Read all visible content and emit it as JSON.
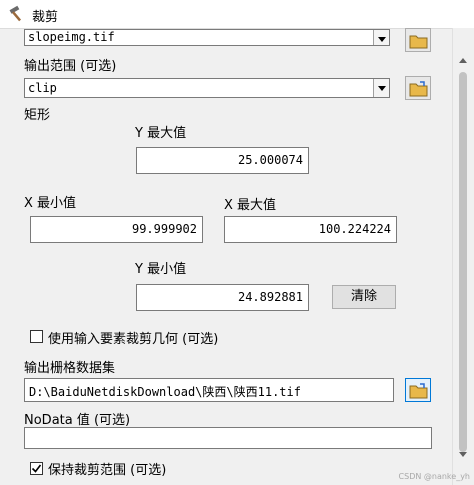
{
  "window": {
    "title": "裁剪",
    "icon": "hammer-icon"
  },
  "input_raster": {
    "value": "slopeimg.tif"
  },
  "output_extent": {
    "label": "输出范围 (可选)",
    "value": "clip"
  },
  "rectangle": {
    "label": "矩形",
    "y_max_label": "Y 最大值",
    "y_max": "25.000074",
    "x_min_label": "X 最小值",
    "x_min": "99.999902",
    "x_max_label": "X 最大值",
    "x_max": "100.224224",
    "y_min_label": "Y 最小值",
    "y_min": "24.892881",
    "clear_label": "清除"
  },
  "use_input_features": {
    "label": "使用输入要素裁剪几何 (可选)",
    "checked": false
  },
  "output_raster": {
    "label": "输出栅格数据集",
    "value": "D:\\BaiduNetdiskDownload\\陕西\\陕西11.tif"
  },
  "nodata": {
    "label": "NoData 值 (可选)",
    "value": ""
  },
  "maintain_extent": {
    "label": "保持裁剪范围 (可选)",
    "checked": true
  },
  "watermark": "CSDN @nanke_yh",
  "colors": {
    "accent": "#0078d7",
    "folder": "#e8b84a"
  }
}
